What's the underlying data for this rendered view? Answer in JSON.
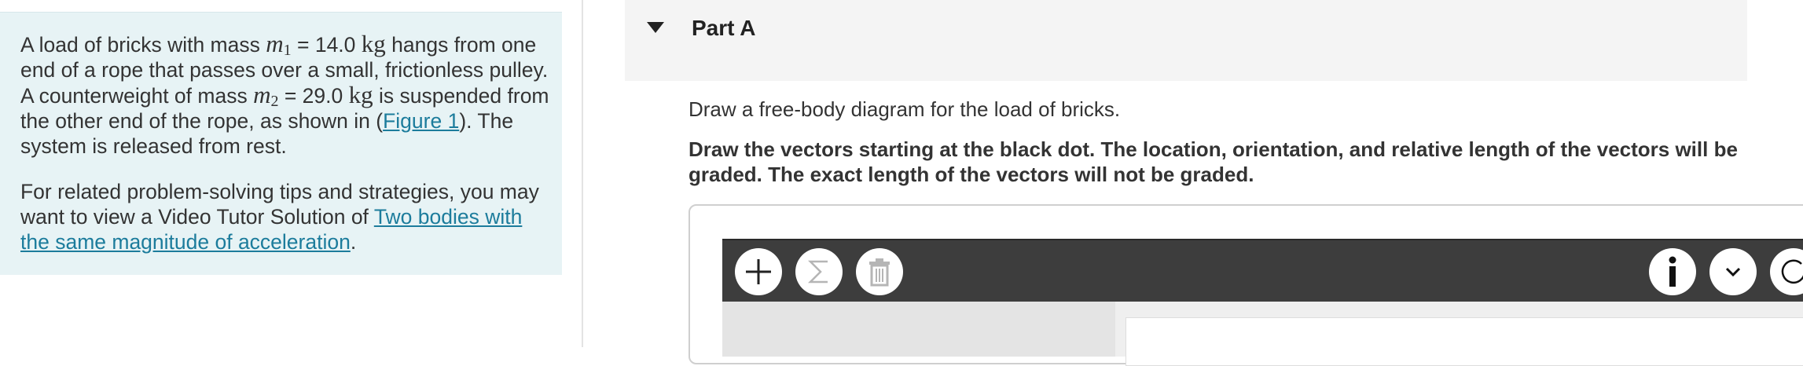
{
  "problem": {
    "p1_a": "A load of bricks with mass ",
    "m1_sym": "m",
    "m1_sub": "1",
    "p1_b": " = 14.0 ",
    "unit_kg": "kg",
    "p1_c": " hangs from one end of a rope that passes over a small, frictionless pulley. A counterweight of mass ",
    "m2_sym": "m",
    "m2_sub": "2",
    "p1_d": " = 29.0 ",
    "p1_e": " is suspended from the other end of the rope, as shown in (",
    "figure_link": "Figure 1",
    "p1_f": "). The system is released from rest.",
    "p2_a": "For related problem-solving tips and strategies, you may want to view a Video Tutor Solution of ",
    "tutor_link": "Two bodies with the same magnitude of acceleration",
    "p2_b": "."
  },
  "part": {
    "title": "Part A",
    "instruction": "Draw a free-body diagram for the load of bricks.",
    "bold_instruction": "Draw the vectors starting at the black dot. The location, orientation, and relative length of the vectors will be graded. The exact length of the vectors will not be graded."
  },
  "toolbar": {
    "icons": [
      "plus-icon",
      "sigma-icon",
      "trash-icon",
      "info-icon",
      "chevron-down-icon",
      "reset-icon"
    ]
  },
  "colors": {
    "left_panel_bg": "#e7f3f5",
    "link": "#1c7c9c",
    "toolbar_bg": "#3d3d3d",
    "part_header_bg": "#f4f4f4"
  }
}
